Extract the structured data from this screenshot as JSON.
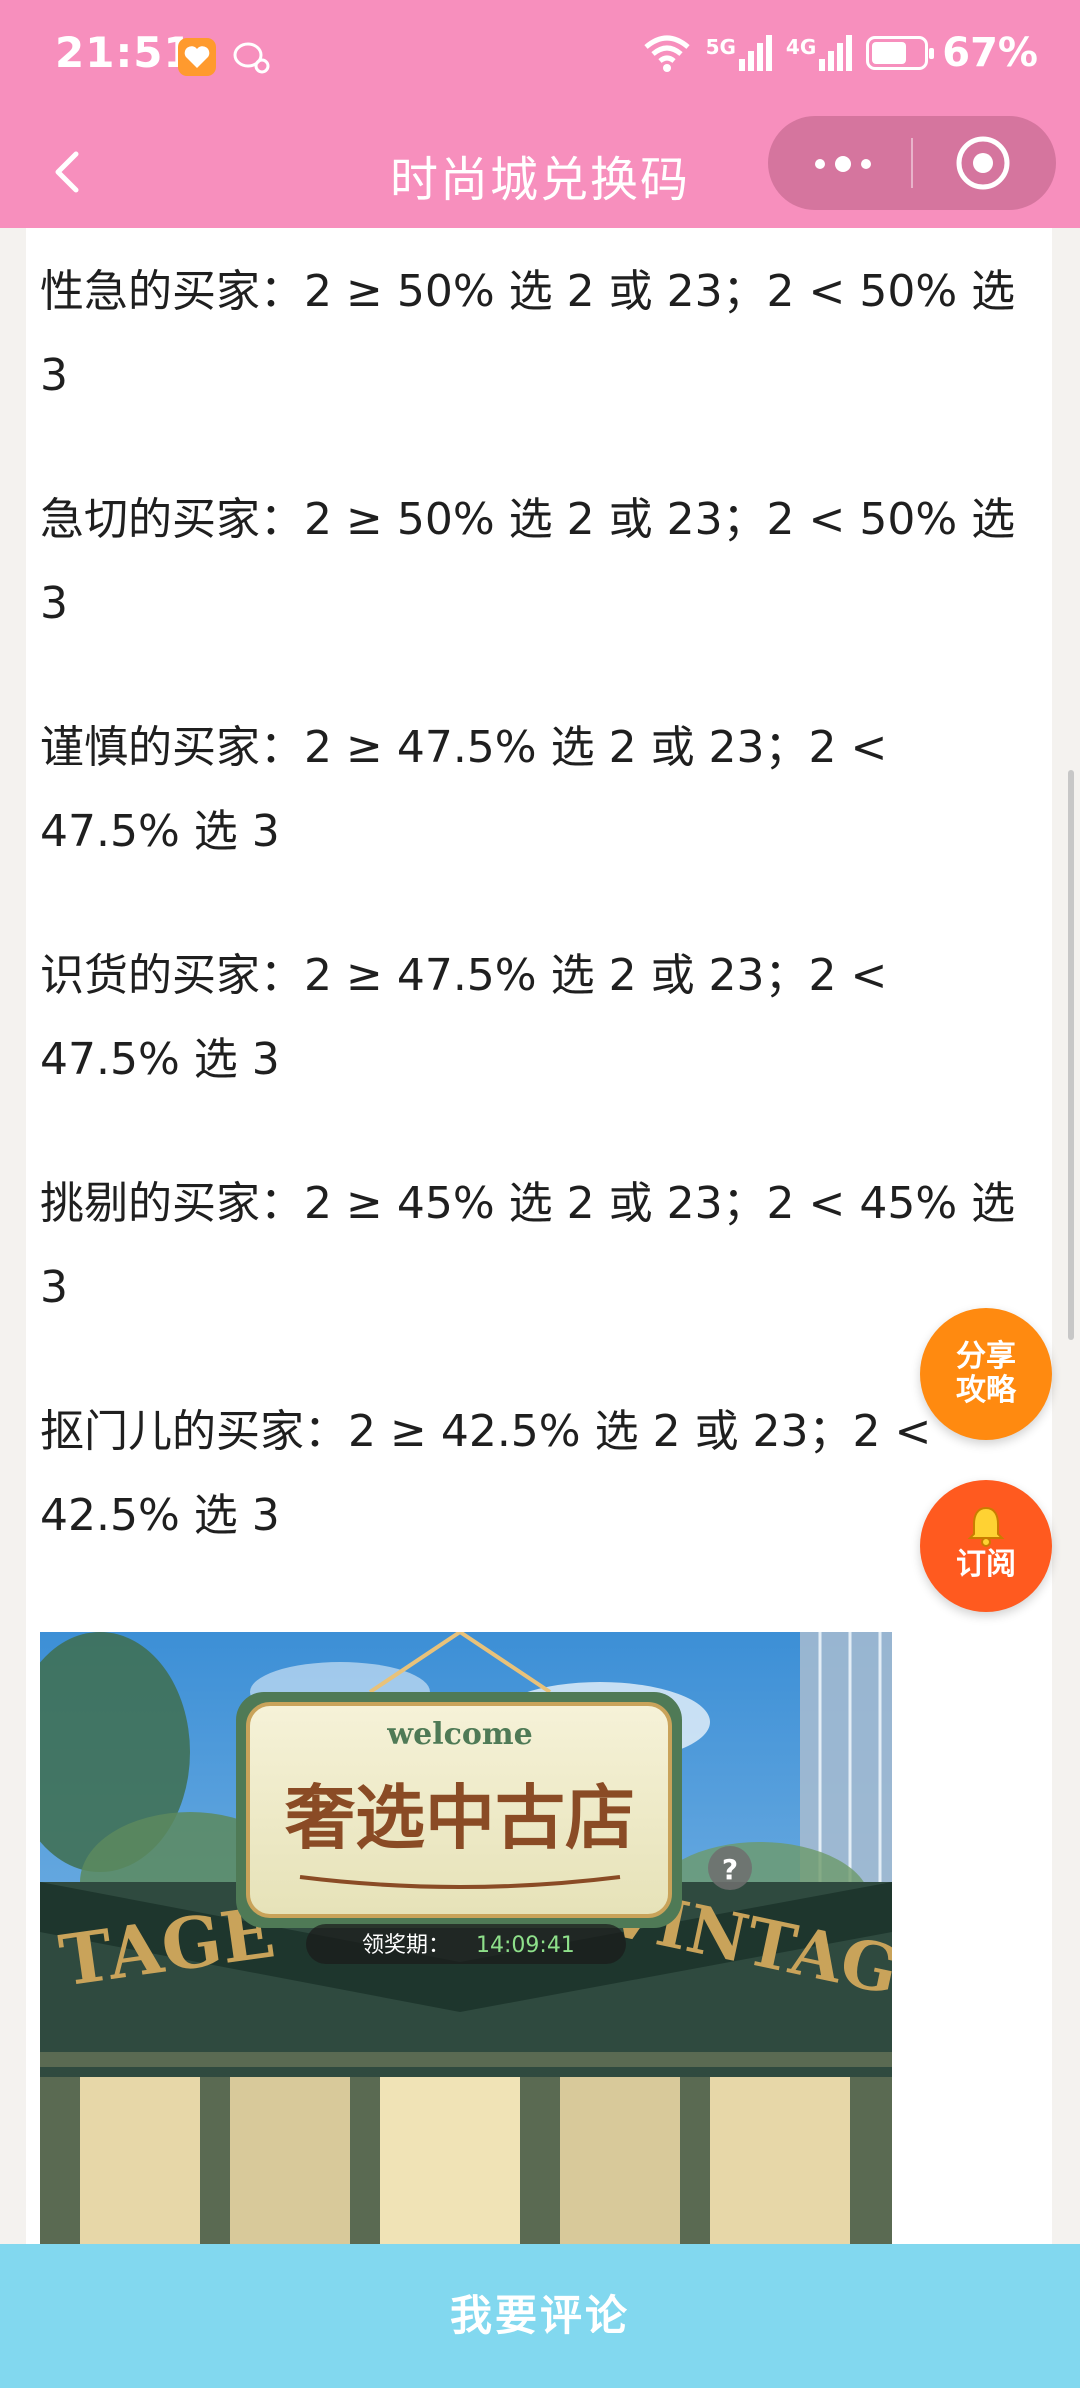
{
  "status_bar": {
    "time": "21:51",
    "battery": "67%",
    "network_labels": [
      "5G",
      "4G"
    ]
  },
  "nav": {
    "title": "时尚城兑换码"
  },
  "paragraphs": [
    {
      "line1": "性急的买家：2 ≥ 50% 选 2 或 23；2 < 50% 选",
      "line2": "3"
    },
    {
      "line1": "急切的买家：2 ≥ 50% 选 2 或 23；2 < 50% 选",
      "line2": "3"
    },
    {
      "line1": "谨慎的买家：2 ≥ 47.5% 选 2 或 23；2 <",
      "line2": "47.5% 选 3"
    },
    {
      "line1": "识货的买家：2 ≥ 47.5% 选 2 或 23；2 <",
      "line2": "47.5% 选 3"
    },
    {
      "line1": "挑剔的买家：2 ≥ 45% 选 2 或 23；2 < 45% 选",
      "line2": "3"
    },
    {
      "line1": "抠门儿的买家：2 ≥ 42.5% 选 2 或 23；2 <",
      "line2": "42.5% 选 3"
    }
  ],
  "game_image": {
    "welcome": "welcome",
    "shop_name": "奢选中古店",
    "timer_label": "领奖期：",
    "timer_value": "14:09:41",
    "help": "?",
    "sign_left": "TAGE",
    "sign_right": "VINTAGE"
  },
  "float_buttons": {
    "share_line1": "分享",
    "share_line2": "攻略",
    "subscribe": "订阅"
  },
  "bottom": {
    "comment_label": "我要评论"
  },
  "colors": {
    "header_pink": "#f78fbd",
    "bottom_blue": "#82d8ef",
    "share_orange": "#ff8a10",
    "subscribe_orange": "#ff5a1f"
  }
}
